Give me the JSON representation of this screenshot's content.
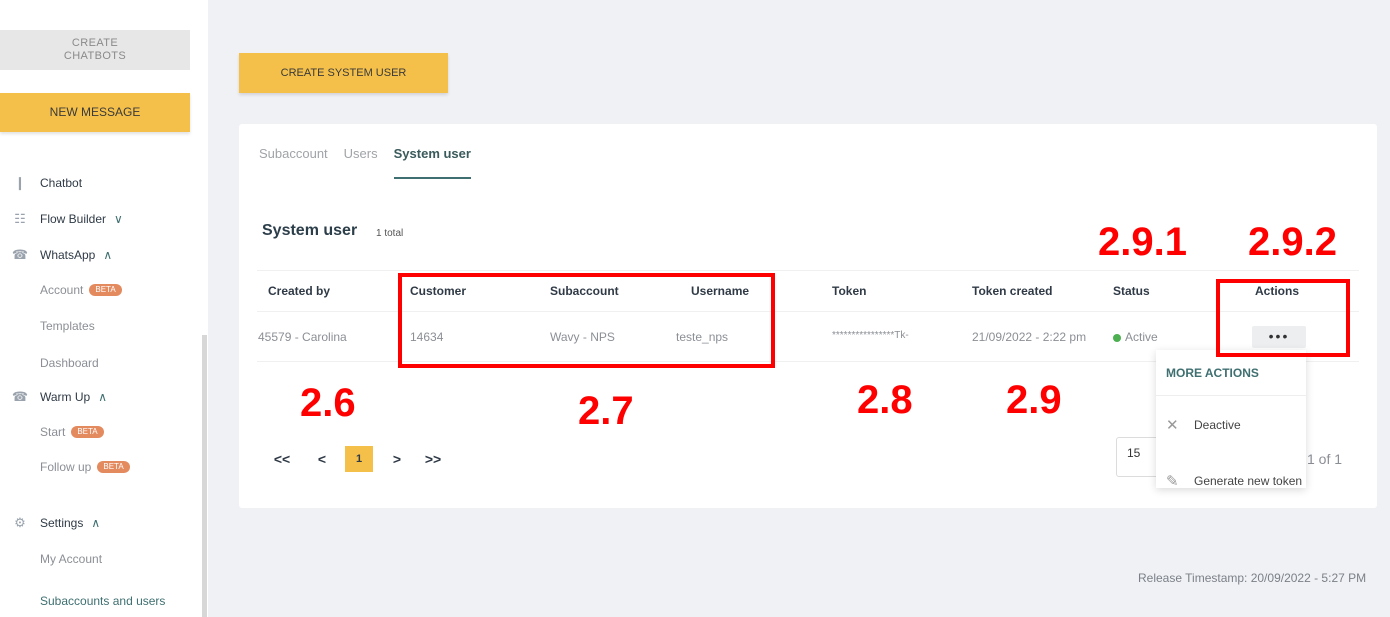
{
  "sidebar": {
    "create_chatbots_line1": "CREATE",
    "create_chatbots_line2": "CHATBOTS",
    "new_message": "NEW MESSAGE",
    "chatbot": "Chatbot",
    "flow_builder": "Flow Builder",
    "whatsapp": "WhatsApp",
    "whatsapp_items": {
      "account": "Account",
      "templates": "Templates",
      "dashboard": "Dashboard"
    },
    "warm_up": "Warm Up",
    "warm_up_items": {
      "start": "Start",
      "follow_up": "Follow up"
    },
    "beta_badge": "BETA",
    "settings": "Settings",
    "settings_items": {
      "my_account": "My Account",
      "subaccounts_and_users": "Subaccounts and users"
    },
    "icons": {
      "chatbot": "chatbot-icon",
      "flow_builder": "flow-icon",
      "whatsapp": "whatsapp-icon",
      "settings": "gear-icon"
    }
  },
  "toolbar": {
    "create_system_user": "CREATE SYSTEM USER"
  },
  "tabs": [
    "Subaccount",
    "Users",
    "System user"
  ],
  "section": {
    "title": "System user",
    "count": "1 total"
  },
  "table": {
    "headers": [
      "Created by",
      "Customer",
      "Subaccount",
      "Username",
      "Token",
      "Token created",
      "Status",
      "Actions"
    ],
    "rows": [
      {
        "created_by": "45579 - Carolina",
        "customer": "14634",
        "subaccount": "Wavy - NPS",
        "username": "teste_nps",
        "token": "****************Tk-",
        "token_created": "21/09/2022 - 2:22 pm",
        "status": "Active",
        "actions": "•••"
      }
    ]
  },
  "pagination": {
    "first": "<<",
    "prev": "<",
    "current": "1",
    "next": ">",
    "last": ">>",
    "page_size": "15",
    "page_of": "1 of 1"
  },
  "more_actions_menu": {
    "title": "MORE ACTIONS",
    "items": [
      "Deactive",
      "Generate new token"
    ]
  },
  "release": "Release Timestamp: 20/09/2022 - 5:27 PM",
  "annotations": [
    "2.6",
    "2.7",
    "2.8",
    "2.9",
    "2.9.1",
    "2.9.2"
  ],
  "colors": {
    "accent": "#f5c04a",
    "annotation": "#ff0000",
    "brand": "#3f6f70",
    "status_active": "#4caf50"
  }
}
